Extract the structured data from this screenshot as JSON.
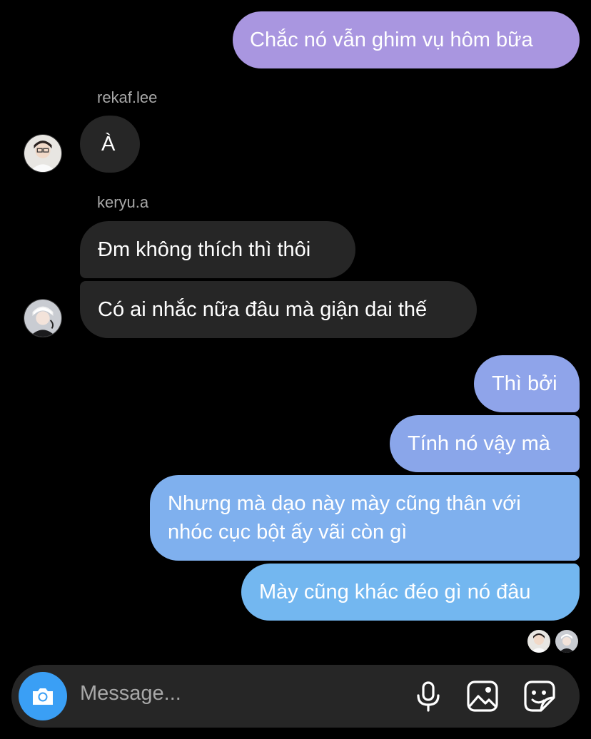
{
  "messages": [
    {
      "text": "Chắc nó vẫn ghim vụ hôm bữa",
      "from": "me",
      "color": "#a996e0"
    },
    {
      "text": "À",
      "from": "rekaf.lee"
    },
    {
      "text": "Đm không thích thì thôi",
      "from": "keryu.a"
    },
    {
      "text": "Có ai nhắc nữa đâu mà giận dai thế",
      "from": "keryu.a"
    },
    {
      "text": "Thì bởi",
      "from": "me",
      "color": "#8fa4ea"
    },
    {
      "text": "Tính nó vậy mà",
      "from": "me",
      "color": "#8aa6ea"
    },
    {
      "lines": [
        "Nhưng mà dạo này mày cũng thân với",
        "nhóc cục bột ấy vãi còn gì"
      ],
      "from": "me",
      "color": "#7fb0ee"
    },
    {
      "text": "Mày cũng khác đéo gì nó đâu",
      "from": "me",
      "color": "#73b7f0"
    }
  ],
  "senders": {
    "first": "rekaf.lee",
    "second": "keryu.a"
  },
  "composer": {
    "placeholder": "Message...",
    "icons": [
      "camera-icon",
      "microphone-icon",
      "gallery-icon",
      "sticker-icon"
    ]
  },
  "colors": {
    "received_bubble": "#262626",
    "camera_button": "#3a9ff5",
    "background": "#000000"
  }
}
